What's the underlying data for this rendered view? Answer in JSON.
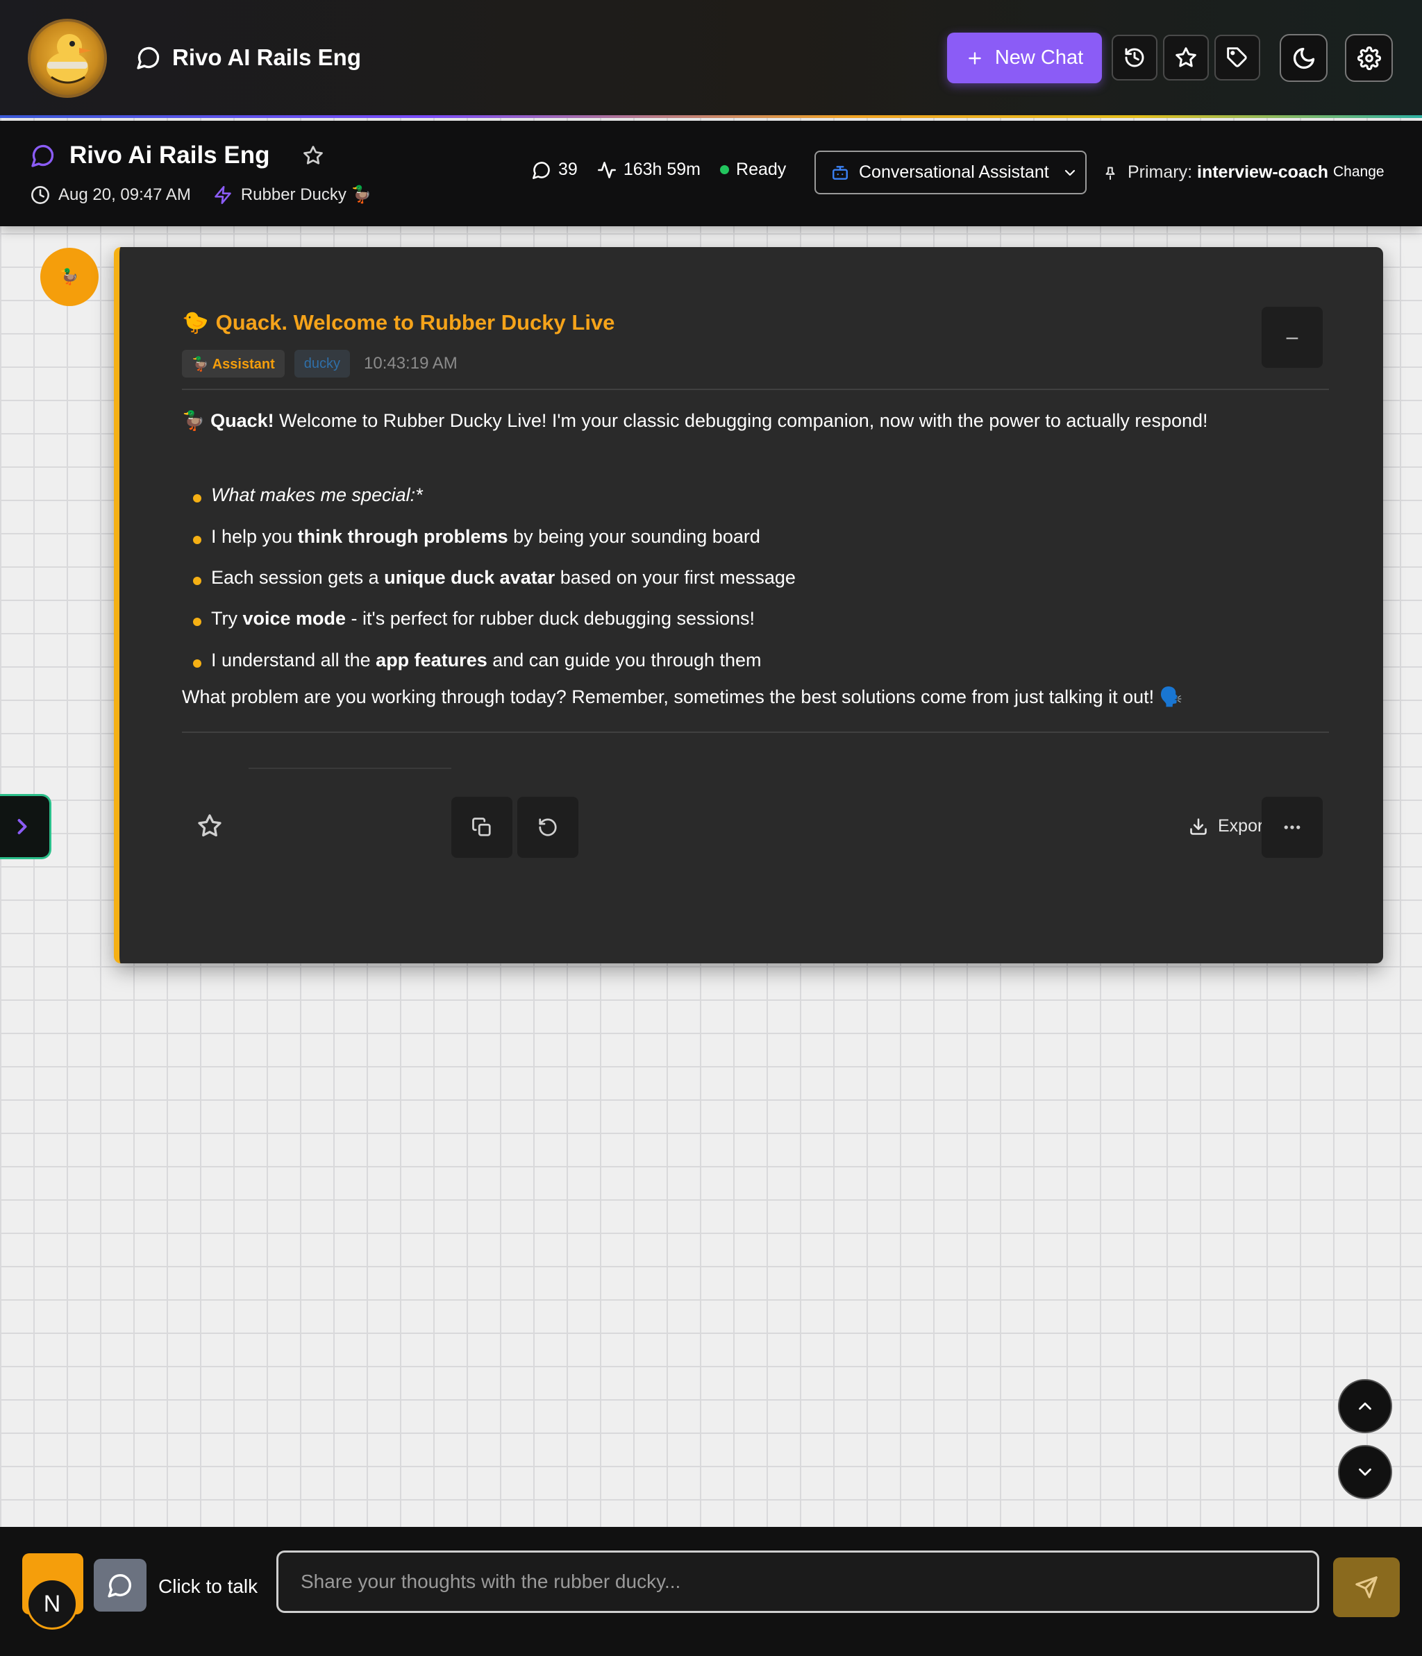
{
  "app": {
    "title": "Rivo AI Rails Eng",
    "new_chat_label": "New Chat",
    "accent_color": "#8b5cf6"
  },
  "toolbar_icons": [
    "history-icon",
    "star-icon",
    "tag-icon",
    "moon-icon",
    "gear-icon"
  ],
  "session": {
    "title": "Rivo Ai Rails Eng",
    "date": "Aug 20, 09:47 AM",
    "persona": "Rubber Ducky 🦆",
    "message_count": "39",
    "duration": "163h 59m",
    "status": "Ready",
    "status_color": "#22c55e",
    "assistant_mode": "Conversational Assistant",
    "primary_label": "Primary:",
    "primary_value": "interview-coach",
    "change_label": "Change"
  },
  "message": {
    "avatar_glyph": "🦆",
    "title": "Quack. Welcome to Rubber Ducky Live",
    "title_emoji": "🐤",
    "role_badge": "🦆 Assistant",
    "tag_badge": "ducky",
    "timestamp": "10:43:19 AM",
    "collapse_label": "–",
    "intro_prefix": "🦆 ",
    "intro_bold": "Quack!",
    "intro_rest": " Welcome to Rubber Ducky Live! I'm your classic debugging companion, now with the power to actually respond!",
    "bullets": [
      {
        "italic": "What makes me special:*"
      },
      {
        "pre": "I help you ",
        "bold": "think through problems",
        "post": " by being your sounding board"
      },
      {
        "pre": "Each session gets a ",
        "bold": "unique duck avatar",
        "post": " based on your first message"
      },
      {
        "pre": "Try ",
        "bold": "voice mode",
        "post": " - it's perfect for rubber duck debugging sessions!"
      },
      {
        "pre": "I understand all the ",
        "bold": "app features",
        "post": " and can guide you through them"
      }
    ],
    "closing": "What problem are you working through today? Remember, sometimes the best solutions come from just talking it out! 🗣️",
    "export_label": "Export",
    "accent_color": "#f5b014"
  },
  "bottom": {
    "user_initial": "N",
    "click_to_talk": "Click to talk",
    "input_placeholder": "Share your thoughts with the rubber ducky...",
    "input_value": ""
  }
}
